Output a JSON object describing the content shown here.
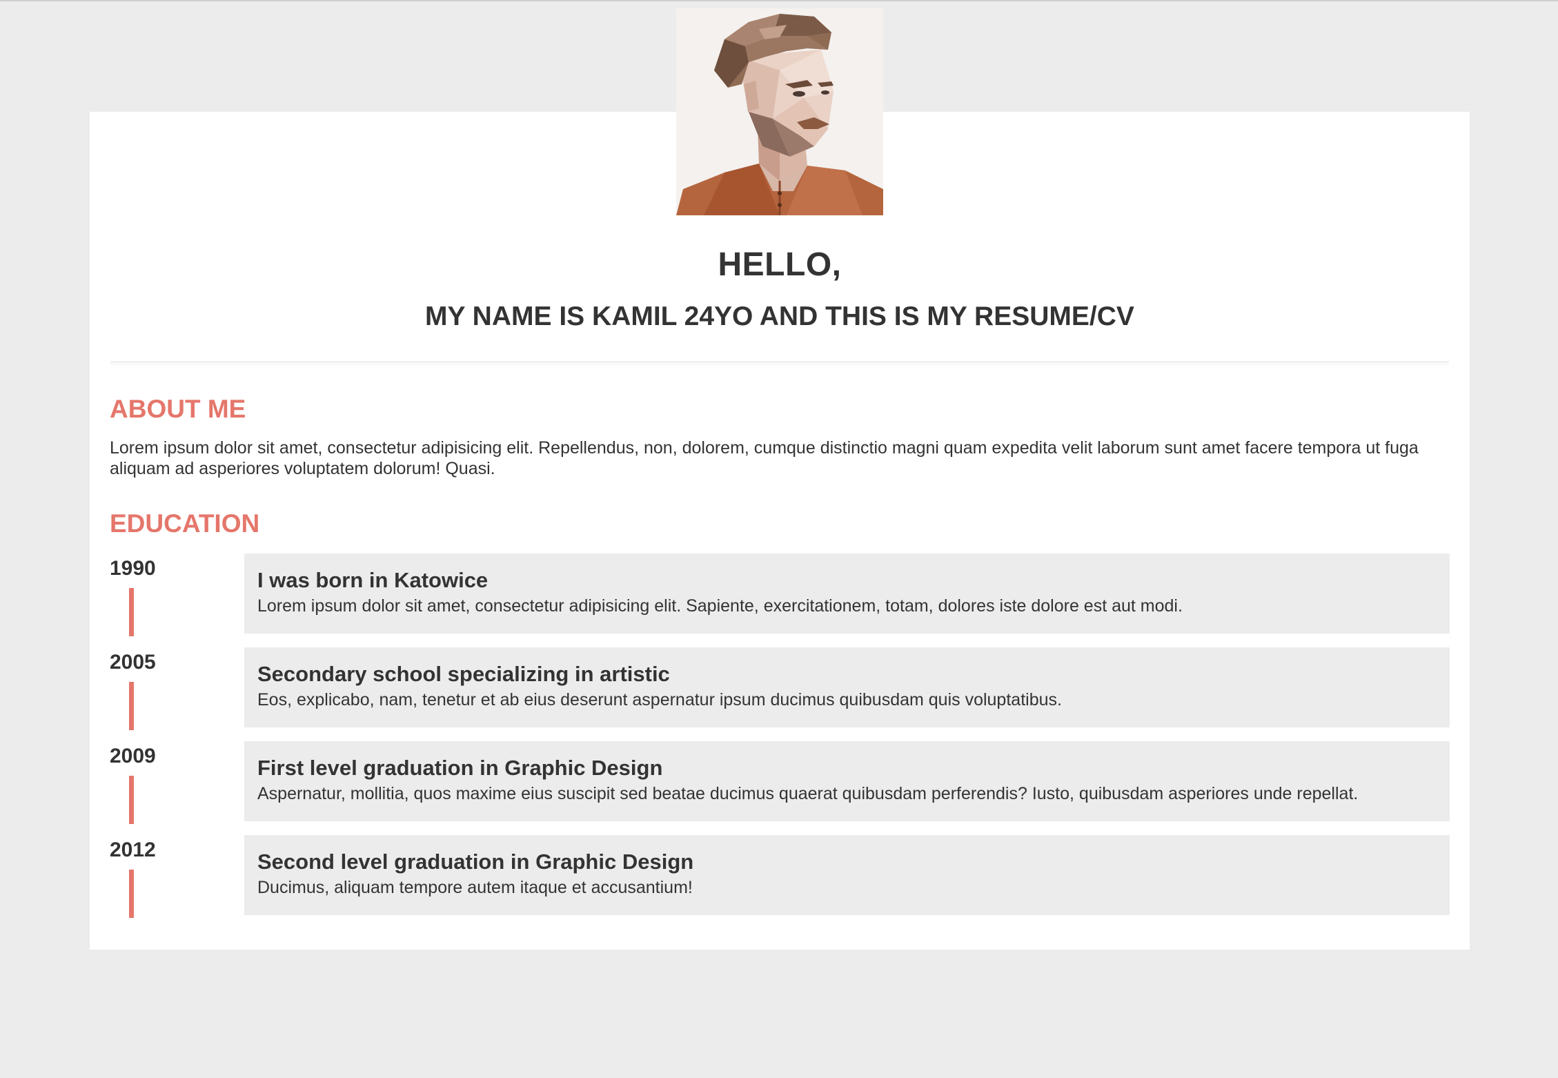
{
  "header": {
    "greeting": "HELLO,",
    "subtitle": "MY NAME IS KAMIL 24YO AND THIS IS MY RESUME/CV"
  },
  "avatar": {
    "icon": "profile-portrait-image",
    "alt": "Kamil"
  },
  "about": {
    "heading": "ABOUT ME",
    "text": "Lorem ipsum dolor sit amet, consectetur adipisicing elit. Repellendus, non, dolorem, cumque distinctio magni quam expedita velit laborum sunt amet facere tempora ut fuga aliquam ad asperiores voluptatem dolorum! Quasi."
  },
  "education": {
    "heading": "EDUCATION",
    "items": [
      {
        "year": "1990",
        "title": "I was born in Katowice",
        "description": "Lorem ipsum dolor sit amet, consectetur adipisicing elit. Sapiente, exercitationem, totam, dolores iste dolore est aut modi."
      },
      {
        "year": "2005",
        "title": "Secondary school specializing in artistic",
        "description": "Eos, explicabo, nam, tenetur et ab eius deserunt aspernatur ipsum ducimus quibusdam quis voluptatibus."
      },
      {
        "year": "2009",
        "title": "First level graduation in Graphic Design",
        "description": "Aspernatur, mollitia, quos maxime eius suscipit sed beatae ducimus quaerat quibusdam perferendis? Iusto, quibusdam asperiores unde repellat."
      },
      {
        "year": "2012",
        "title": "Second level graduation in Graphic Design",
        "description": "Ducimus, aliquam tempore autem itaque et accusantium!"
      }
    ]
  },
  "colors": {
    "accent": "#e5766b",
    "page_background": "#ececec",
    "card_background": "#ffffff",
    "text": "#333333"
  }
}
